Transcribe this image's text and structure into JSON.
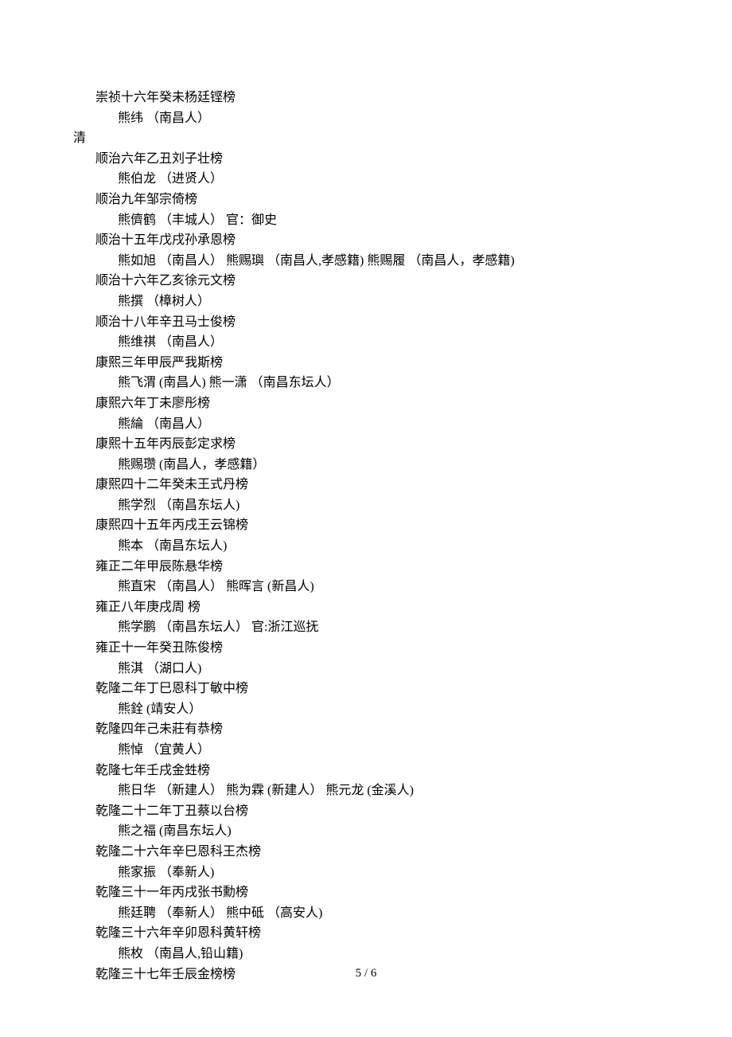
{
  "lines": [
    {
      "indent": "l2",
      "text": "崇祯十六年癸未杨廷铿榜"
    },
    {
      "indent": "l3",
      "text": "熊纬 （南昌人）"
    },
    {
      "indent": "l1",
      "text": "清"
    },
    {
      "indent": "l2",
      "text": "顺治六年乙丑刘子壮榜"
    },
    {
      "indent": "l3",
      "text": "熊伯龙 （进贤人）"
    },
    {
      "indent": "l2",
      "text": "顺治九年邹宗倚榜"
    },
    {
      "indent": "l3",
      "text": "熊儕鹤 （丰城人） 官：御史"
    },
    {
      "indent": "l2",
      "text": "顺治十五年戊戌孙承恩榜"
    },
    {
      "indent": "l3",
      "text": "熊如旭 （南昌人） 熊赐璵 （南昌人,孝感籍) 熊赐履 （南昌人，孝感籍)"
    },
    {
      "indent": "l2",
      "text": "顺治十六年乙亥徐元文榜"
    },
    {
      "indent": "l3",
      "text": "熊撰 （樟树人）"
    },
    {
      "indent": "l2",
      "text": "顺治十八年辛丑马士俊榜"
    },
    {
      "indent": "l3",
      "text": "熊维祺 （南昌人）"
    },
    {
      "indent": "l2",
      "text": "康熙三年甲辰严我斯榜"
    },
    {
      "indent": "l3",
      "text": "熊飞渭 (南昌人) 熊一潇 （南昌东坛人）"
    },
    {
      "indent": "l2",
      "text": "康熙六年丁未廖彤榜"
    },
    {
      "indent": "l3",
      "text": "熊綸 （南昌人）"
    },
    {
      "indent": "l2",
      "text": "康熙十五年丙辰彭定求榜"
    },
    {
      "indent": "l3",
      "text": "熊赐瓒 (南昌人，孝感籍）"
    },
    {
      "indent": "l2",
      "text": "康熙四十二年癸未王式丹榜"
    },
    {
      "indent": "l3",
      "text": "熊学烈 （南昌东坛人)"
    },
    {
      "indent": "l2",
      "text": "康熙四十五年丙戌王云锦榜"
    },
    {
      "indent": "l3",
      "text": "熊本 （南昌东坛人)"
    },
    {
      "indent": "l2",
      "text": "雍正二年甲辰陈悬华榜"
    },
    {
      "indent": "l3",
      "text": "熊直宋 （南昌人） 熊晖言 (新昌人)"
    },
    {
      "indent": "l2",
      "text": "雍正八年庚戌周 榜"
    },
    {
      "indent": "l3",
      "text": "熊学鹏 （南昌东坛人） 官:浙江巡抚"
    },
    {
      "indent": "l2",
      "text": "雍正十一年癸丑陈俊榜"
    },
    {
      "indent": "l3",
      "text": "熊淇 （湖口人)"
    },
    {
      "indent": "l2",
      "text": "乾隆二年丁巳恩科丁敏中榜"
    },
    {
      "indent": "l3",
      "text": "熊銓 (靖安人）"
    },
    {
      "indent": "l2",
      "text": "乾隆四年己未莊有恭榜"
    },
    {
      "indent": "l3",
      "text": "熊悼 （宜黄人）"
    },
    {
      "indent": "l2",
      "text": "乾隆七年壬戌金甡榜"
    },
    {
      "indent": "l3",
      "text": "熊日华 （新建人） 熊为霖 (新建人） 熊元龙 (金溪人)"
    },
    {
      "indent": "l2",
      "text": "乾隆二十二年丁丑蔡以台榜"
    },
    {
      "indent": "l3",
      "text": "熊之福 (南昌东坛人)"
    },
    {
      "indent": "l2",
      "text": "乾隆二十六年辛巳恩科王杰榜"
    },
    {
      "indent": "l3",
      "text": "熊家振 （奉新人)"
    },
    {
      "indent": "l2",
      "text": "乾隆三十一年丙戌张书勳榜"
    },
    {
      "indent": "l3",
      "text": "熊廷聘 （奉新人） 熊中砥 （高安人)"
    },
    {
      "indent": "l2",
      "text": "乾隆三十六年辛卯恩科黄轩榜"
    },
    {
      "indent": "l3",
      "text": "熊枚 （南昌人,铅山籍)"
    },
    {
      "indent": "l2",
      "text": "乾隆三十七年壬辰金榜榜"
    }
  ],
  "footer": "5 / 6"
}
